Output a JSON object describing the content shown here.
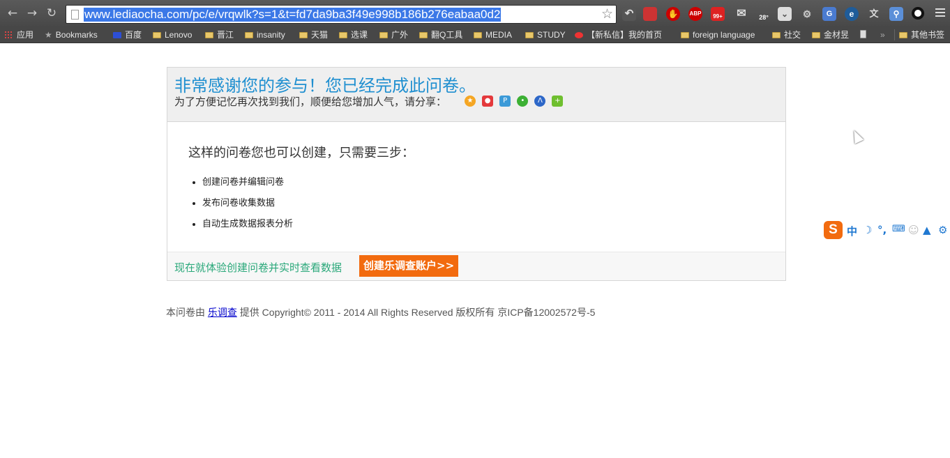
{
  "browser": {
    "url": "www.lediaocha.com/pc/e/vrqwlk?s=1&t=fd7da9ba3f49e998b186b276eabaa0d2",
    "bookmarks": [
      {
        "label": "应用",
        "type": "apps"
      },
      {
        "label": "Bookmarks",
        "type": "star"
      },
      {
        "label": "百度",
        "type": "site"
      },
      {
        "label": "Lenovo",
        "type": "folder"
      },
      {
        "label": "晋江",
        "type": "folder"
      },
      {
        "label": "insanity",
        "type": "folder"
      },
      {
        "label": "天猫",
        "type": "folder"
      },
      {
        "label": "选课",
        "type": "folder"
      },
      {
        "label": "广外",
        "type": "folder"
      },
      {
        "label": "翻Q工具",
        "type": "folder"
      },
      {
        "label": "MEDIA",
        "type": "folder"
      },
      {
        "label": "STUDY",
        "type": "folder"
      },
      {
        "label": "【新私信】我的首页",
        "type": "site"
      },
      {
        "label": "foreign language",
        "type": "folder"
      },
      {
        "label": "社交",
        "type": "folder"
      },
      {
        "label": "金材昱",
        "type": "folder"
      }
    ],
    "more_bookmarks": "»",
    "other_bookmarks": "其他书签",
    "extensions": {
      "abp": "ABP",
      "badge_count": "99+",
      "weather_temp": "28°"
    }
  },
  "page": {
    "thanks_heading": "非常感谢您的参与！您已经完成此问卷。",
    "share_prompt": "为了方便记忆再次找到我们，顺便给您增加人气，请分享：",
    "steps_title": "这样的问卷您也可以创建，只需要三步：",
    "steps": [
      "创建问卷并编辑问卷",
      "发布问卷收集数据",
      "自动生成数据报表分析"
    ],
    "footer_promo": "现在就体验创建问卷并实时查看数据",
    "create_button": "创建乐调查账户>>",
    "footer": {
      "prefix": "本问卷由",
      "link": "乐调查",
      "suffix": "提供  Copyright© 2011 - 2014 All Rights Reserved 版权所有  京ICP备12002572号-5"
    }
  },
  "ime": {
    "logo": "S",
    "mode": "中",
    "punct": "°,"
  }
}
